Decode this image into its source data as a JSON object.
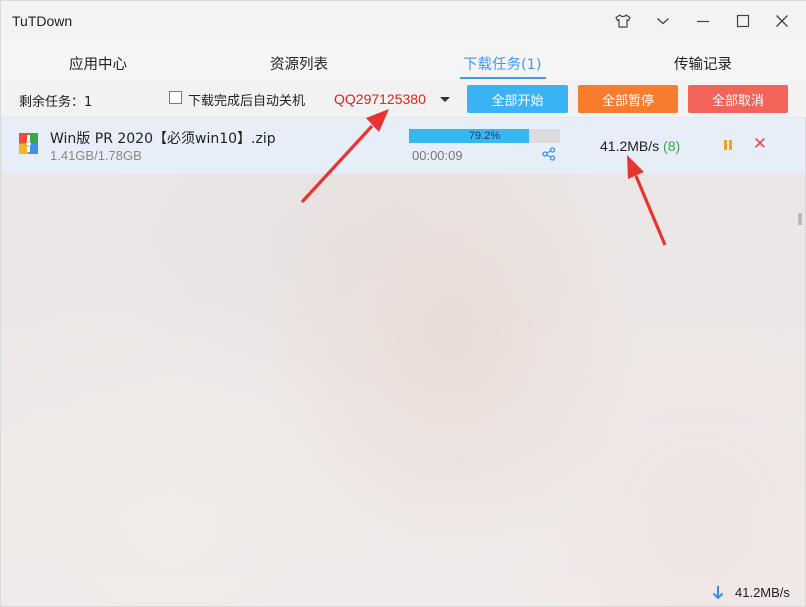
{
  "window": {
    "title": "TuTDown"
  },
  "tabs": [
    {
      "label": "应用中心"
    },
    {
      "label": "资源列表"
    },
    {
      "label": "下载任务(1)"
    },
    {
      "label": "传输记录"
    }
  ],
  "toolbar": {
    "remaining": "剩余任务：1",
    "auto_shutdown_label": "下载完成后自动关机",
    "auto_shutdown_checked": false,
    "qq_value": "QQ297125380",
    "start_all": "全部开始",
    "pause_all": "全部暂停",
    "cancel_all": "全部取消"
  },
  "task": {
    "name": "Win版 PR 2020【必须win10】.zip",
    "size": "1.41GB/1.78GB",
    "progress_text": "79.2%",
    "progress_value": 0.792,
    "elapsed": "00:00:09",
    "speed": "41.2MB/s",
    "connections": "(8)"
  },
  "status": {
    "total_speed": "41.2MB/s"
  },
  "icons": {
    "skin": "shirt-icon",
    "menu": "chevron-down-icon",
    "minimize": "minimize-icon",
    "maximize": "maximize-icon",
    "close": "close-icon",
    "file": "archive-file-icon",
    "share": "share-icon",
    "pause": "pause-icon",
    "cancel": "cancel-icon",
    "download": "download-arrow-icon"
  },
  "colors": {
    "accent": "#3d9cf0",
    "start_btn": "#39b3f3",
    "pause_btn": "#f87c2e",
    "cancel_btn": "#f2635a",
    "progress": "#35b7f0",
    "qq_text": "#e32219",
    "arrow": "#e8332e"
  }
}
